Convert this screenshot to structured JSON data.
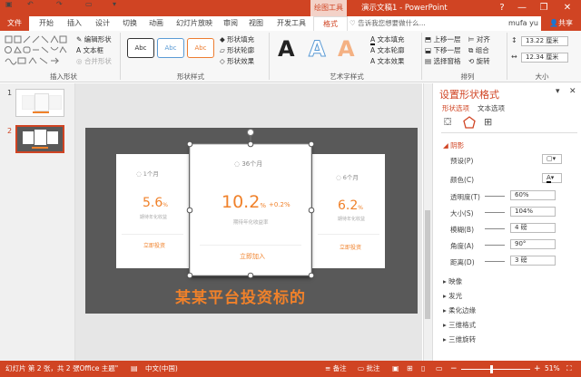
{
  "titlebar": {
    "contextual_tab": "绘图工具",
    "doc_title": "演示文稿1 - PowerPoint",
    "window_buttons": [
      "?",
      "—",
      "❐",
      "✕"
    ]
  },
  "menu": {
    "file": "文件",
    "tabs": [
      "开始",
      "插入",
      "设计",
      "切换",
      "动画",
      "幻灯片放映",
      "审阅",
      "视图",
      "开发工具"
    ],
    "format": "格式",
    "search_placeholder": "♡ 告诉我您想要做什么...",
    "user": "mufa yu",
    "share": "共享"
  },
  "ribbon": {
    "insert_shapes": {
      "label": "插入形状",
      "edit_shape": "编辑形状",
      "text_box": "文本框",
      "merge_shapes": "合并形状"
    },
    "shape_styles": {
      "label": "形状样式",
      "presets": [
        "Abc",
        "Abc",
        "Abc"
      ],
      "fill": "形状填充",
      "outline": "形状轮廓",
      "effects": "形状效果"
    },
    "wordart": {
      "label": "艺术字样式",
      "text_fill": "文本填充",
      "text_outline": "文本轮廓",
      "text_effects": "文本效果"
    },
    "arrange": {
      "label": "排列",
      "bring_forward": "上移一层",
      "send_backward": "下移一层",
      "selection_pane": "选择窗格",
      "align": "对齐",
      "group": "组合",
      "rotate": "旋转"
    },
    "size": {
      "label": "大小",
      "height": "13.22 厘米",
      "width": "12.34 厘米"
    }
  },
  "thumbnails": {
    "numbers": [
      "1",
      "2"
    ]
  },
  "slide": {
    "left_card": {
      "term": "1个月",
      "rate": "5.6",
      "pct": "%",
      "caption": "期待年化收益",
      "link": "立即投资"
    },
    "center_card": {
      "term": "36个月",
      "rate": "10.2",
      "pct": "%",
      "bonus": "+0.2%",
      "caption": "期待年化收益率",
      "link": "立即加入"
    },
    "right_card": {
      "term": "6个月",
      "rate": "6.2",
      "pct": "%",
      "caption": "期待年化收益",
      "link": "立即投资"
    },
    "headline": "某某平台投资标的"
  },
  "format_pane": {
    "title": "设置形状格式",
    "tab_shape": "形状选项",
    "tab_text": "文本选项",
    "shadow_label": "阴影",
    "preset": "预设(P)",
    "color": "颜色(C)",
    "transparency": {
      "label": "透明度(T)",
      "value": "60%"
    },
    "size": {
      "label": "大小(S)",
      "value": "104%"
    },
    "blur": {
      "label": "模糊(B)",
      "value": "4 磅"
    },
    "angle": {
      "label": "角度(A)",
      "value": "90°"
    },
    "distance": {
      "label": "距离(D)",
      "value": "3 磅"
    },
    "sections": [
      "映像",
      "发光",
      "柔化边缘",
      "三维格式",
      "三维旋转"
    ]
  },
  "status": {
    "slide_info": "幻灯片 第 2 张，共 2 张",
    "theme": "\"Office 主题\"",
    "language": "中文(中国)",
    "notes": "备注",
    "comments": "批注",
    "zoom": "51%"
  },
  "colors": {
    "accent": "#d04423",
    "orange": "#f0812a",
    "slide_bg": "#595959"
  }
}
